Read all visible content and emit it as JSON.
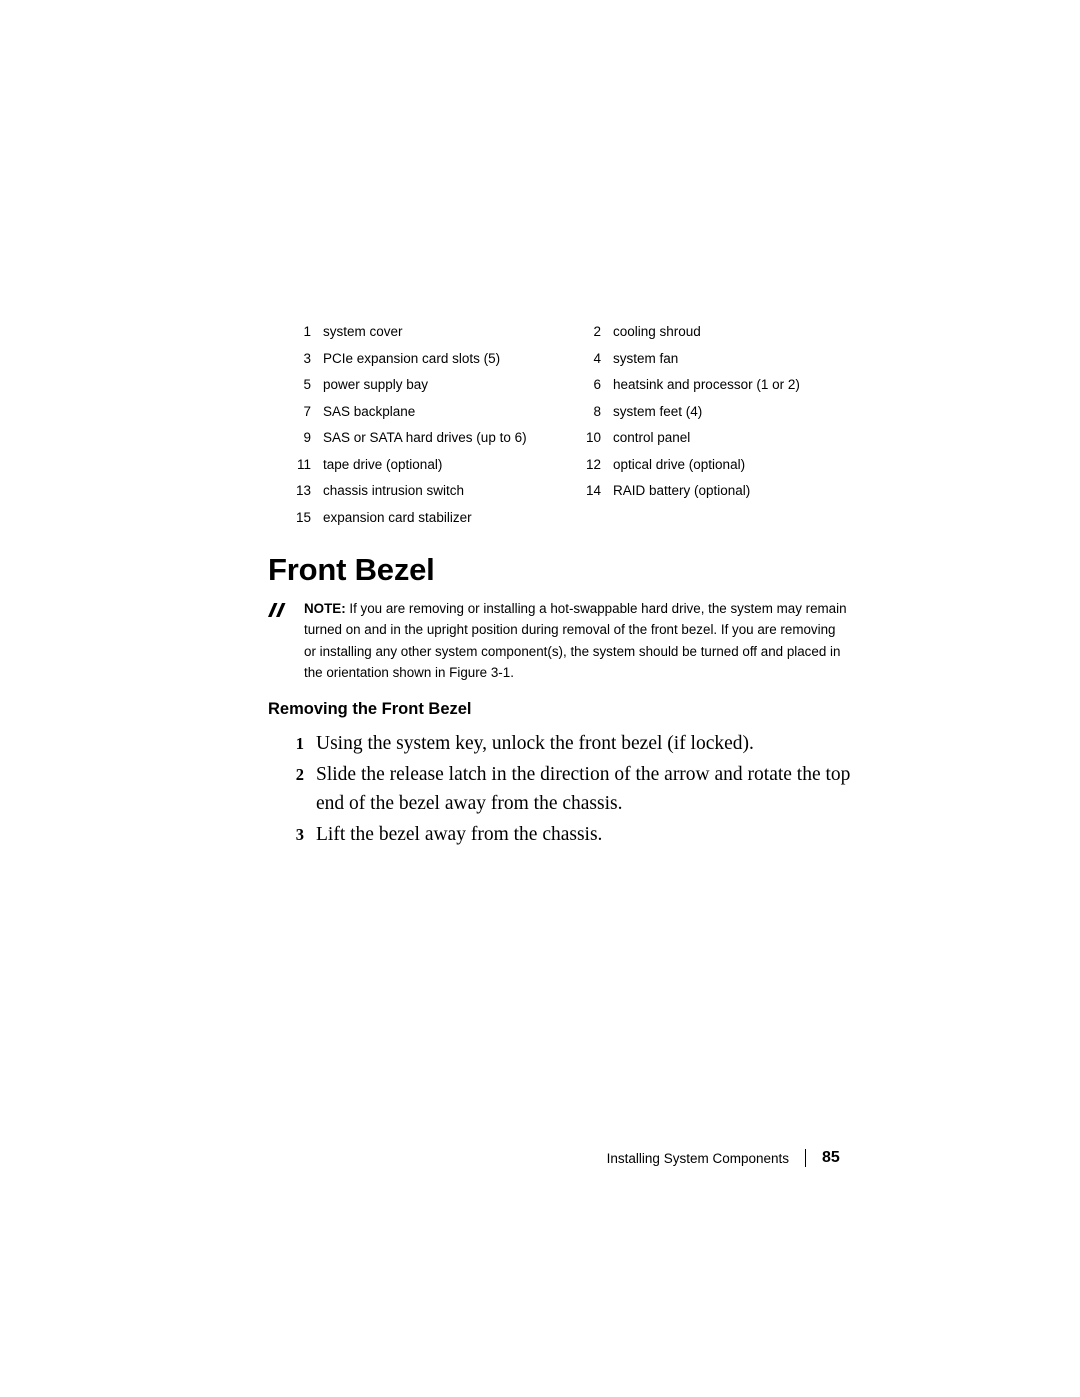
{
  "legend": {
    "rows": [
      [
        {
          "num": "1",
          "label": "system cover"
        },
        {
          "num": "2",
          "label": "cooling shroud"
        }
      ],
      [
        {
          "num": "3",
          "label": "PCIe expansion card slots (5)"
        },
        {
          "num": "4",
          "label": "system fan"
        }
      ],
      [
        {
          "num": "5",
          "label": "power supply bay"
        },
        {
          "num": "6",
          "label": "heatsink and processor (1 or 2)"
        }
      ],
      [
        {
          "num": "7",
          "label": "SAS backplane"
        },
        {
          "num": "8",
          "label": "system feet (4)"
        }
      ],
      [
        {
          "num": "9",
          "label": "SAS or SATA hard drives (up to 6)"
        },
        {
          "num": "10",
          "label": "control panel"
        }
      ],
      [
        {
          "num": "11",
          "label": "tape drive (optional)"
        },
        {
          "num": "12",
          "label": "optical drive (optional)"
        }
      ],
      [
        {
          "num": "13",
          "label": "chassis intrusion switch"
        },
        {
          "num": "14",
          "label": "RAID battery (optional)"
        }
      ],
      [
        {
          "num": "15",
          "label": "expansion card stabilizer"
        },
        {
          "num": "",
          "label": ""
        }
      ]
    ]
  },
  "heading": "Front Bezel",
  "note": {
    "label": "NOTE:",
    "text": " If you are removing or installing a hot-swappable hard drive, the system may remain turned on and in the upright position during removal of the front bezel. If you are removing or installing any other system component(s), the system should be turned off and placed in the orientation shown in Figure 3-1."
  },
  "subheading": "Removing the Front Bezel",
  "steps": [
    {
      "num": "1",
      "text": "Using the system key, unlock the front bezel (if locked)."
    },
    {
      "num": "2",
      "text": "Slide the release latch in the direction of the arrow and rotate the top end of the bezel away from the chassis."
    },
    {
      "num": "3",
      "text": "Lift the bezel away from the chassis."
    }
  ],
  "footer": {
    "section": "Installing System Components",
    "page": "85"
  }
}
